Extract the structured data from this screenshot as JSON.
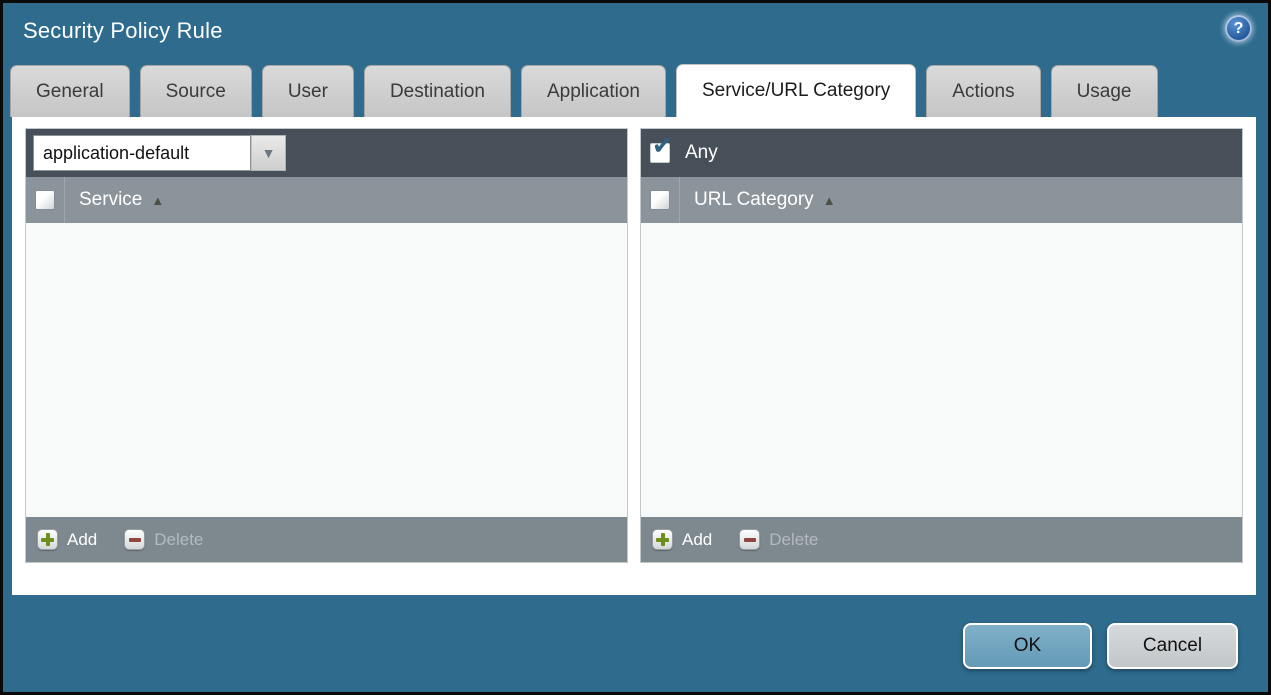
{
  "dialog": {
    "title": "Security Policy Rule"
  },
  "icons": {
    "help": "?",
    "dropdown_arrow": "▼",
    "sort_asc": "▲",
    "check": "✔"
  },
  "tabs": [
    {
      "label": "General",
      "active": false
    },
    {
      "label": "Source",
      "active": false
    },
    {
      "label": "User",
      "active": false
    },
    {
      "label": "Destination",
      "active": false
    },
    {
      "label": "Application",
      "active": false
    },
    {
      "label": "Service/URL Category",
      "active": true
    },
    {
      "label": "Actions",
      "active": false
    },
    {
      "label": "Usage",
      "active": false
    }
  ],
  "service_panel": {
    "dropdown_value": "application-default",
    "column_header": "Service",
    "rows": [],
    "add_label": "Add",
    "delete_label": "Delete",
    "delete_enabled": false
  },
  "url_category_panel": {
    "any_label": "Any",
    "any_checked": true,
    "column_header": "URL Category",
    "rows": [],
    "add_label": "Add",
    "delete_label": "Delete",
    "delete_enabled": false
  },
  "footer_buttons": {
    "ok": "OK",
    "cancel": "Cancel"
  },
  "colors": {
    "titlebar_background": "#2e6b8d",
    "panel_toolbar_dark": "#475059",
    "column_header_gray": "#8b949b",
    "footer_gray": "#7e888f",
    "ok_button_blue": "#6fa1bc",
    "add_plus_green": "#6e8e1d",
    "delete_minus_red": "#91463f",
    "check_blue": "#2d6384"
  }
}
